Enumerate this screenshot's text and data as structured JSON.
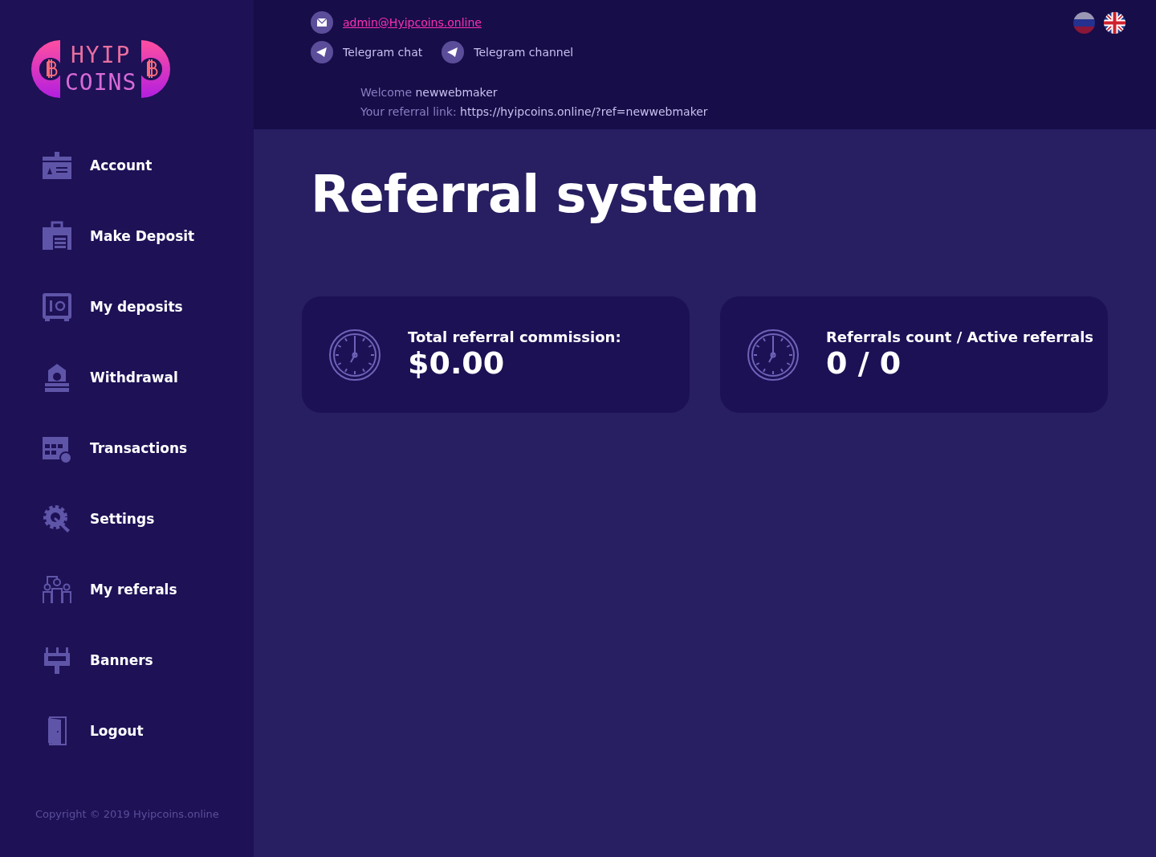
{
  "logo": {
    "line_1": "HYIP",
    "line_2": "COINS"
  },
  "sidebar": {
    "items": [
      {
        "label": "Account",
        "kind": "id-card"
      },
      {
        "label": "Make Deposit",
        "kind": "briefcase"
      },
      {
        "label": "My deposits",
        "kind": "safe"
      },
      {
        "label": "Withdrawal",
        "kind": "bank"
      },
      {
        "label": "Transactions",
        "kind": "calendar"
      },
      {
        "label": "Settings",
        "kind": "gear"
      },
      {
        "label": "My referals",
        "kind": "people"
      },
      {
        "label": "Banners",
        "kind": "billboard"
      },
      {
        "label": "Logout",
        "kind": "door"
      }
    ],
    "copyright": "Copyright © 2019 Hyipcoins.online"
  },
  "header": {
    "email": "admin@Hyipcoins.online",
    "links": [
      "Telegram chat",
      "Telegram channel"
    ],
    "welcome_label": "Welcome",
    "username": "newwebmaker",
    "referral_label": "Your referral link:",
    "referral_link": "https://hyipcoins.online/?ref=newwebmaker",
    "languages": [
      {
        "kind": "ru"
      },
      {
        "kind": "en"
      }
    ]
  },
  "page_title": "Referral system",
  "cards": [
    {
      "label": "Total referral commission:",
      "value": "$0.00"
    },
    {
      "label": "Referrals count / Active referrals",
      "value": "0 / 0"
    }
  ]
}
